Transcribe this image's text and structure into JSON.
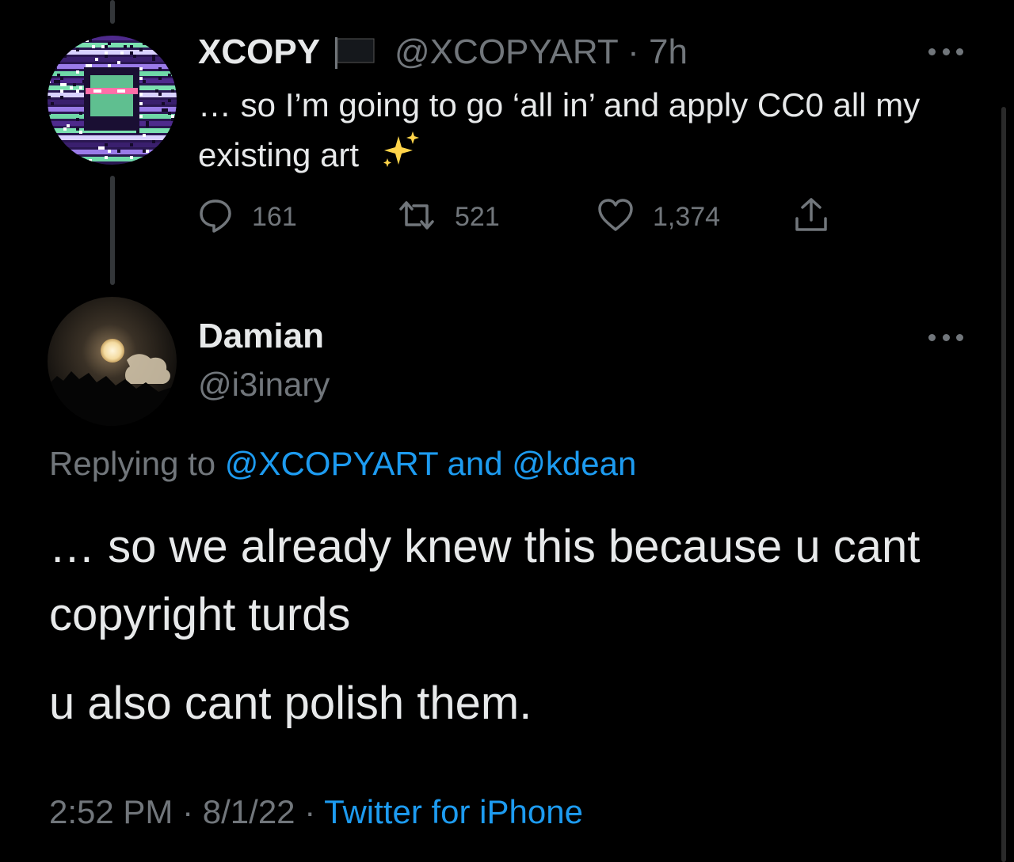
{
  "tweet": {
    "author_name": "XCOPY",
    "author_handle": "@XCOPYART",
    "separator": "·",
    "time_ago": "7h",
    "text": "… so I’m going to go ‘all in’ and apply CC0 all my existing art",
    "emoji_icon": "sparkles-icon",
    "flag_icon": "black-flag-icon",
    "reply_count": "161",
    "retweet_count": "521",
    "like_count": "1,374"
  },
  "reply": {
    "author_name": "Damian",
    "author_handle": "@i3inary",
    "replying_label": "Replying to",
    "mention_1": "@XCOPYART",
    "conjunction": "and",
    "mention_2": "@kdean",
    "paragraphs": [
      "… so we already knew this because u cant copyright turds",
      "u also cant polish them."
    ],
    "time": "2:52 PM",
    "date": "8/1/22",
    "separator": "·",
    "source": "Twitter for iPhone"
  },
  "colors": {
    "background": "#000000",
    "text_primary": "#e7e9ea",
    "text_secondary": "#71767b",
    "link": "#1d9bf0",
    "thread_line": "#333639"
  }
}
